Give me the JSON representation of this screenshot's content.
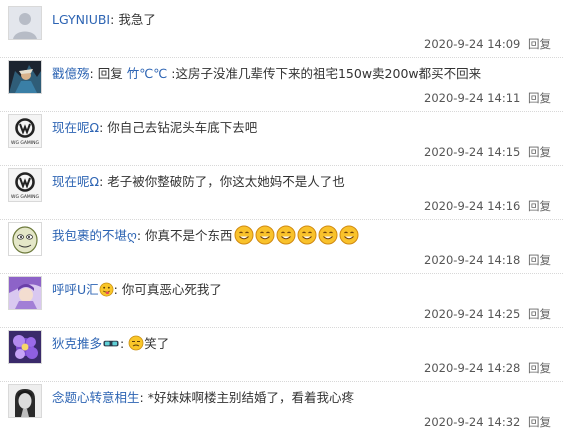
{
  "replies": [
    {
      "username": "LGYNIUBI",
      "text": "我急了",
      "time": "2020-9-24 14:09",
      "reply_label": "回复",
      "avatar": "default-avatar-icon"
    },
    {
      "username": "戳億殇",
      "reply_prefix": "回复",
      "reply_target": "竹℃℃",
      "text": ":这房子没准几辈传下来的祖宅150w卖200w都买不回来",
      "time": "2020-9-24 14:11",
      "reply_label": "回复",
      "avatar": "dark-character-avatar"
    },
    {
      "username": "现在呢Ω",
      "text": "你自己去钻泥头车底下去吧",
      "time": "2020-9-24 14:15",
      "reply_label": "回复",
      "avatar": "wg-logo-avatar",
      "avatar_caption": "WG GAMING"
    },
    {
      "username": "现在呢Ω",
      "text": "老子被你整破防了，你这太她妈不是人了也",
      "time": "2020-9-24 14:16",
      "reply_label": "回复",
      "avatar": "wg-logo-avatar",
      "avatar_caption": "WG GAMING"
    },
    {
      "username": "我包裹的不堪ღ",
      "text": "你真不是个东西",
      "time": "2020-9-24 14:18",
      "reply_label": "回复",
      "avatar": "cartoon-face-avatar",
      "emoji_count": 6
    },
    {
      "username": "呼呼U汇",
      "text": "你可真恶心死我了",
      "time": "2020-9-24 14:25",
      "reply_label": "回复",
      "avatar": "purple-character-avatar"
    },
    {
      "username": "狄克推多",
      "text": "笑了",
      "time": "2020-9-24 14:28",
      "reply_label": "回复",
      "avatar": "purple-flower-avatar"
    },
    {
      "username": "念题心转意相生",
      "text": "*好妹妹啊楼主别结婚了，看着我心疼",
      "time": "2020-9-24 14:32",
      "reply_label": "回复",
      "avatar": "bw-girl-avatar"
    }
  ],
  "colors": {
    "username": "#2d64b3",
    "text": "#333333",
    "meta": "#666666",
    "divider": "#d8d8d8"
  }
}
